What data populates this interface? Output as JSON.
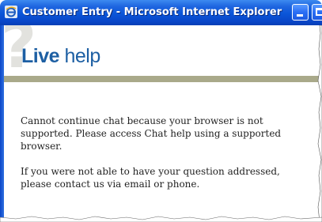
{
  "window": {
    "title": "Customer Entry - Microsoft Internet Explorer",
    "icon": "ie-icon"
  },
  "header": {
    "logo_live": "Live",
    "logo_help": " help"
  },
  "message": {
    "paragraph1": "Cannot continue chat because your browser is not supported. Please access Chat help using a supported browser.",
    "paragraph2": "If you were not able to have your question addressed, please contact us via email or phone."
  },
  "colors": {
    "titlebar": "#0a55d8",
    "logo": "#1d5fa3",
    "divider": "#a9a98a"
  }
}
